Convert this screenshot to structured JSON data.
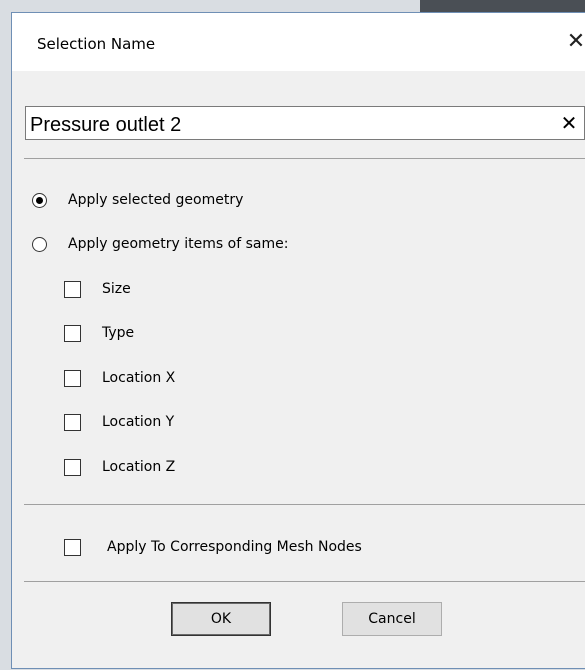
{
  "dialog": {
    "title": "Selection Name",
    "close_glyph": "✕"
  },
  "name_field": {
    "value": "Pressure outlet 2",
    "clear_glyph": "✕"
  },
  "options": {
    "radios": [
      {
        "label": "Apply selected geometry",
        "checked": true
      },
      {
        "label": "Apply geometry items of same:",
        "checked": false
      }
    ],
    "checkboxes": [
      {
        "label": "Size",
        "checked": false
      },
      {
        "label": "Type",
        "checked": false
      },
      {
        "label": "Location X",
        "checked": false
      },
      {
        "label": "Location Y",
        "checked": false
      },
      {
        "label": "Location Z",
        "checked": false
      }
    ],
    "mesh_nodes": {
      "label": "Apply To Corresponding Mesh Nodes",
      "checked": false
    }
  },
  "buttons": {
    "ok_label": "OK",
    "cancel_label": "Cancel"
  }
}
